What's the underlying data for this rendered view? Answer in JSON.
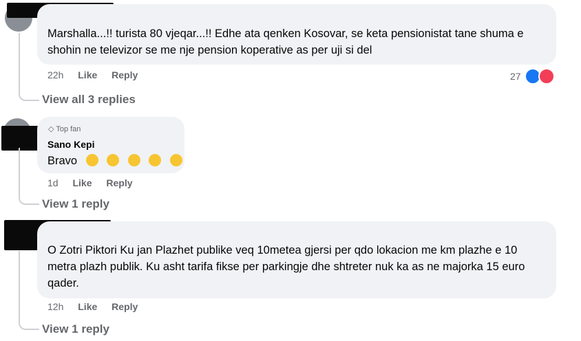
{
  "comments": [
    {
      "text": "Marshalla...!! turista 80 vjeqar...!! Edhe ata qenken Kosovar, se keta pensionistat tane shuma e shohin ne televizor se me nje pension koperative as per uji si del",
      "time": "22h",
      "like": "Like",
      "reply": "Reply",
      "reaction_count": "27",
      "view_replies": "View all 3 replies"
    },
    {
      "badge": "Top fan",
      "author": "Sano Kepi",
      "text": "Bravo",
      "emoji_count": 5,
      "time": "1d",
      "like": "Like",
      "reply": "Reply",
      "view_replies": "View 1 reply"
    },
    {
      "text": "O Zotri Piktori Ku jan Plazhet publike veq 10metea gjersi per qdo lokacion me km plazhe e 10 metra plazh publik. Ku asht tarifa fikse per parkingje dhe shtreter nuk ka as ne majorka 15 euro qader.",
      "time": "12h",
      "like": "Like",
      "reply": "Reply",
      "view_replies": "View 1 reply"
    }
  ],
  "colors": {
    "like_blue": "#1877f2",
    "love_red": "#f33e58",
    "bubble": "#f0f2f5",
    "meta": "#65676b"
  }
}
